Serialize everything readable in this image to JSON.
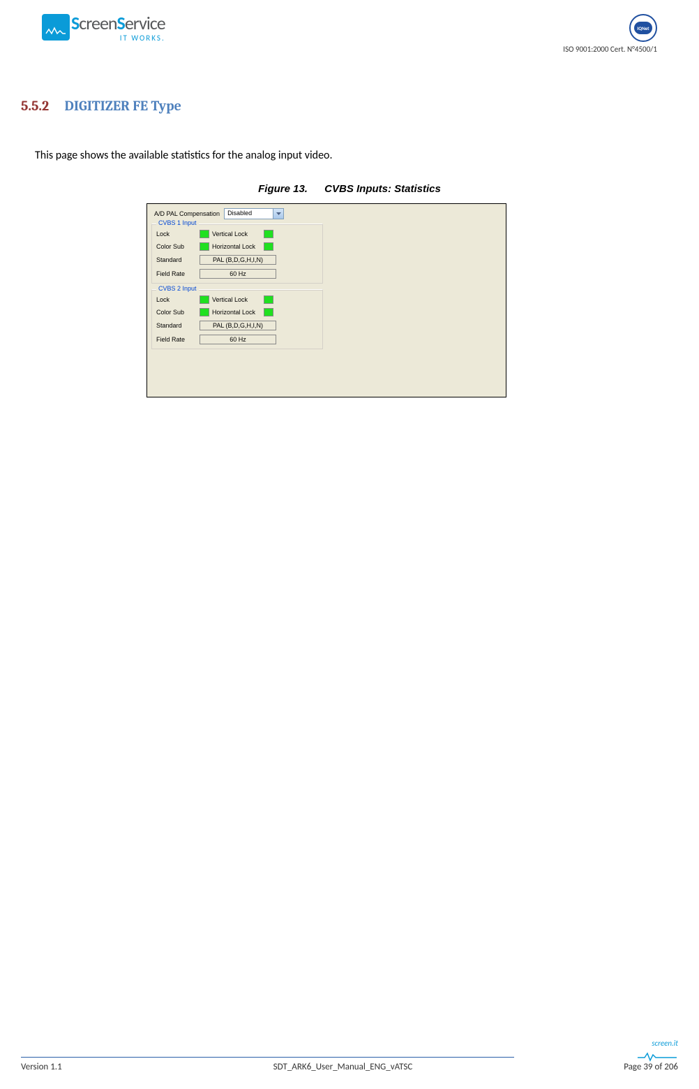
{
  "header": {
    "logo_company": "ScreenService",
    "logo_tagline": "IT WORKS.",
    "iqnet": "IQNet",
    "iso_cert": "ISO 9001:2000 Cert. N°4500/1"
  },
  "section": {
    "number": "5.5.2",
    "title": "DIGITIZER FE Type"
  },
  "body": {
    "intro": "This page shows the available statistics for the analog input video."
  },
  "figure": {
    "label": "Figure 13.",
    "caption": "CVBS Inputs: Statistics"
  },
  "ui": {
    "ad_pal_label": "A/D PAL Compensation",
    "ad_pal_value": "Disabled",
    "groups": [
      {
        "legend": "CVBS 1 Input",
        "lock": "Lock",
        "vlock": "Vertical Lock",
        "colorsub": "Color Sub",
        "hlock": "Horizontal Lock",
        "standard_label": "Standard",
        "standard_value": "PAL (B,D,G,H,I,N)",
        "fieldrate_label": "Field Rate",
        "fieldrate_value": "60 Hz"
      },
      {
        "legend": "CVBS 2 Input",
        "lock": "Lock",
        "vlock": "Vertical Lock",
        "colorsub": "Color Sub",
        "hlock": "Horizontal Lock",
        "standard_label": "Standard",
        "standard_value": "PAL (B,D,G,H,I,N)",
        "fieldrate_label": "Field Rate",
        "fieldrate_value": "60 Hz"
      }
    ]
  },
  "footer": {
    "version": "Version 1.1",
    "doc": "SDT_ARK6_User_Manual_ENG_vATSC",
    "page": "Page 39 of 206",
    "brand": "screen.it"
  }
}
